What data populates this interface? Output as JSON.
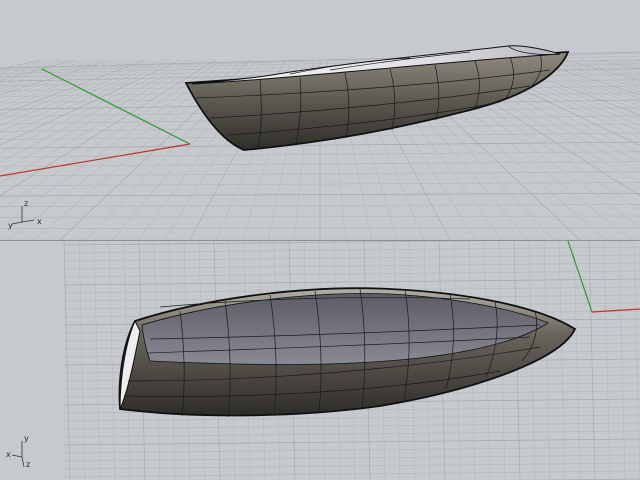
{
  "viewports": [
    {
      "id": "top",
      "axis_labels": {
        "x": "x",
        "y": "y",
        "z": "z"
      }
    },
    {
      "id": "bottom",
      "axis_labels": {
        "x": "x",
        "y": "y",
        "z": "z"
      }
    }
  ],
  "colors": {
    "background": "#c6c9cd",
    "grid_minor": "#b5b8bc",
    "grid_major": "#a4a7ab",
    "x_axis": "#c2332b",
    "y_axis": "#2e9a33",
    "hull_dark": "#3a3833",
    "hull_light": "#8f8b80",
    "hull_interior": "#e6e6ea",
    "wireframe": "#111111"
  },
  "icons": [
    "axis-triad-icon"
  ]
}
